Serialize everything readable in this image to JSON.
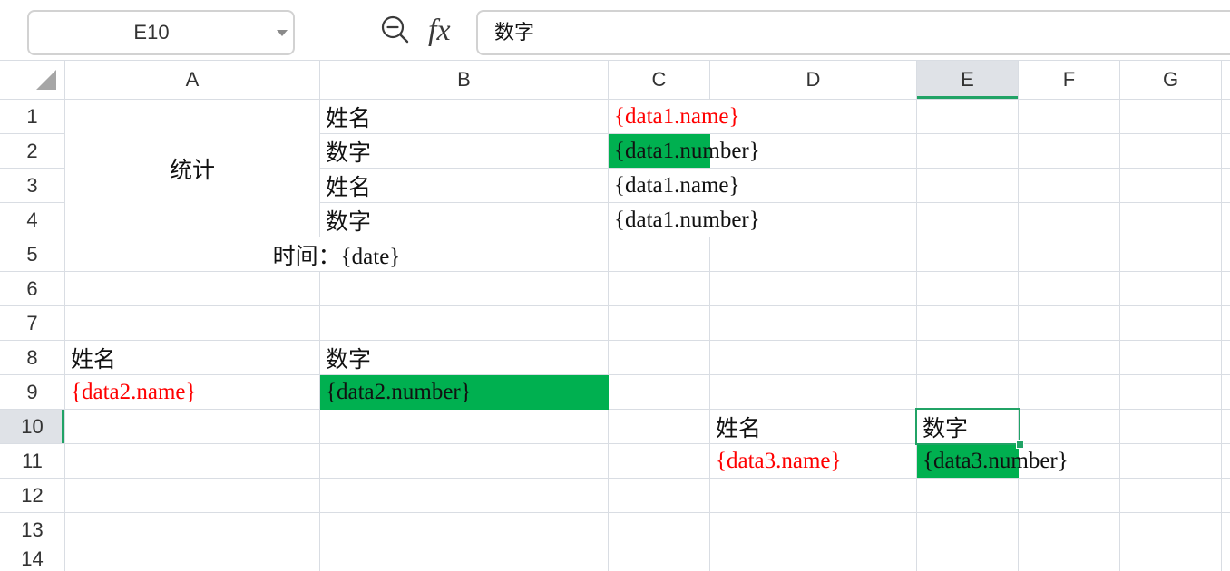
{
  "name_box": {
    "value": "E10"
  },
  "formula_bar": {
    "fx_label": "fx",
    "value": "数字"
  },
  "icons": {
    "name_box_dropdown": "chevron-down-icon",
    "formula_zoom": "zoom-out-icon",
    "select_all": "select-all-triangle-icon"
  },
  "colors": {
    "accent": "#21a366",
    "fill_green": "#00b050",
    "text_red": "#ff0000",
    "gridline": "#d9dde3",
    "header_selected": "#dfe2e7"
  },
  "sheet": {
    "columns": [
      "A",
      "B",
      "C",
      "D",
      "E",
      "F",
      "G"
    ],
    "rows": [
      "1",
      "2",
      "3",
      "4",
      "5",
      "6",
      "7",
      "8",
      "9",
      "10",
      "11",
      "12",
      "13",
      "14"
    ]
  },
  "cells": {
    "A1": "统计",
    "B1": "姓名",
    "C1": "{data1.name}",
    "B2": "数字",
    "C2": "{data1.number}",
    "B3": "姓名",
    "C3": "{data1.name}",
    "B4": "数字",
    "C4": "{data1.number}",
    "A5": "时间：{date}",
    "A8": "姓名",
    "B8": "数字",
    "A9": "{data2.name}",
    "B9": "{data2.number}",
    "D10": "姓名",
    "E10": "数字",
    "D11": "{data3.name}",
    "E11": "{data3.number}"
  }
}
